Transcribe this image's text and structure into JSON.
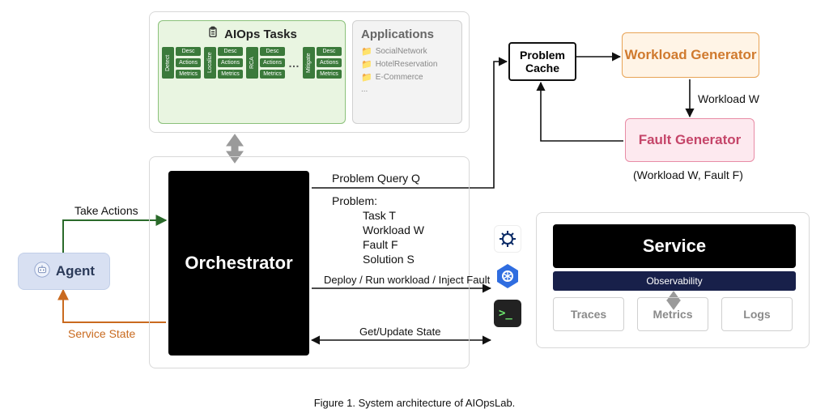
{
  "caption": "Figure 1. System architecture of AIOpsLab.",
  "agent": {
    "label": "Agent"
  },
  "arrows": {
    "take_actions": "Take Actions",
    "service_state": "Service State"
  },
  "top": {
    "aiops_title": "AIOps Tasks",
    "task_cols": [
      "Detect",
      "Localize",
      "RCA",
      "Mitigate"
    ],
    "task_rows": [
      "Desc",
      "Actions",
      "Metrics"
    ],
    "apps_title": "Applications",
    "apps": [
      "SocialNetwork",
      "HotelReservation",
      "E-Commerce",
      "..."
    ]
  },
  "orchestrator": {
    "label": "Orchestrator",
    "problem_query": "Problem Query Q",
    "problem_header": "Problem:",
    "problem_lines": [
      "Task T",
      "Workload W",
      "Fault F",
      "Solution S"
    ],
    "deploy_line": "Deploy / Run workload / Inject Fault",
    "state_line": "Get/Update State"
  },
  "cache": {
    "label": "Problem Cache"
  },
  "workload_gen": {
    "label": "Workload Generator",
    "out": "Workload W"
  },
  "fault_gen": {
    "label": "Fault Generator",
    "out": "(Workload W, Fault F)"
  },
  "service": {
    "label": "Service",
    "observability": "Observability",
    "telemetry": [
      "Traces",
      "Metrics",
      "Logs"
    ]
  },
  "icons": {
    "helm": "HELM",
    "k8s": "kubernetes-icon",
    "term": ">_"
  }
}
